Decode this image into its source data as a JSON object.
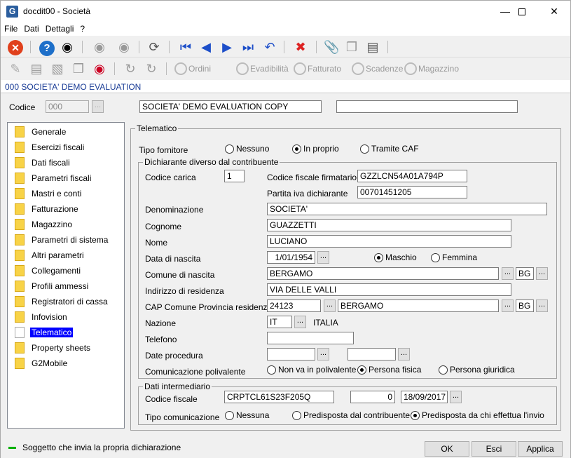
{
  "window": {
    "title": "docdit00 - Società",
    "icon": "G"
  },
  "menu": [
    "File",
    "Dati",
    "Dettagli",
    "?"
  ],
  "toolbar2": {
    "ordini": "Ordini",
    "evadibilita": "Evadibilità",
    "fatturato": "Fatturato",
    "scadenze": "Scadenze",
    "magazzino": "Magazzino"
  },
  "header": {
    "band": "000 SOCIETA'  DEMO EVALUATION",
    "codice_label": "Codice",
    "codice_value": "000",
    "descrizione": "SOCIETA'  DEMO EVALUATION COPY",
    "descrizione2": ""
  },
  "tree": [
    "Generale",
    "Esercizi fiscali",
    "Dati fiscali",
    "Parametri fiscali",
    "Mastri e conti",
    "Fatturazione",
    "Magazzino",
    "Parametri di sistema",
    "Altri parametri",
    "Collegamenti",
    "Profili ammessi",
    "Registratori di cassa",
    "Infovision",
    "Telematico",
    "Property sheets",
    "G2Mobile"
  ],
  "telematico": {
    "group_title": "Telematico",
    "tipo_fornitore_label": "Tipo fornitore",
    "tipo_fornitore_options": [
      "Nessuno",
      "In proprio",
      "Tramite CAF"
    ],
    "tipo_fornitore_selected": "In proprio",
    "dich_title": "Dichiarante diverso dal contribuente",
    "codice_carica_label": "Codice carica",
    "codice_carica": "1",
    "cf_firmatario_label": "Codice fiscale firmatario",
    "cf_firmatario": "GZZLCN54A01A794P",
    "piva_label": "Partita iva dichiarante",
    "piva": "00701451205",
    "denominazione_label": "Denominazione",
    "denominazione": "SOCIETA'",
    "cognome_label": "Cognome",
    "cognome": "GUAZZETTI",
    "nome_label": "Nome",
    "nome": "LUCIANO",
    "data_nascita_label": "Data di nascita",
    "data_nascita": "1/01/1954",
    "sesso_options": [
      "Maschio",
      "Femmina"
    ],
    "sesso_selected": "Maschio",
    "comune_nascita_label": "Comune di nascita",
    "comune_nascita": "BERGAMO",
    "prov_nascita": "BG",
    "indirizzo_label": "Indirizzo di residenza",
    "indirizzo": "VIA DELLE VALLI",
    "cap_label": "CAP Comune Provincia residenza",
    "cap": "24123",
    "comune_res": "BERGAMO",
    "prov_res": "BG",
    "nazione_label": "Nazione",
    "nazione_code": "IT",
    "nazione_name": "ITALIA",
    "telefono_label": "Telefono",
    "telefono": "",
    "date_procedura_label": "Date procedura",
    "comunicazione_label": "Comunicazione polivalente",
    "comunicazione_options": [
      "Non va in polivalente",
      "Persona fisica",
      "Persona giuridica"
    ],
    "comunicazione_selected": "Persona fisica",
    "interm_title": "Dati intermediario",
    "interm_cf_label": "Codice fiscale",
    "interm_cf": "CRPTCL61S23F205Q",
    "interm_num": "0",
    "interm_data": "18/09/2017",
    "tipo_com_label": "Tipo comunicazione",
    "tipo_com_options": [
      "Nessuna",
      "Predisposta dal contribuente",
      "Predisposta da chi effettua l'invio"
    ],
    "tipo_com_selected": "Predisposta da chi effettua l'invio"
  },
  "status": {
    "text": "Soggetto che invia la propria dichiarazione",
    "indicator_color": "#00b000"
  },
  "buttons": {
    "ok": "OK",
    "esci": "Esci",
    "applica": "Applica"
  },
  "colors": {
    "band_text": "#1a3c96",
    "selection": "#0000ff"
  }
}
